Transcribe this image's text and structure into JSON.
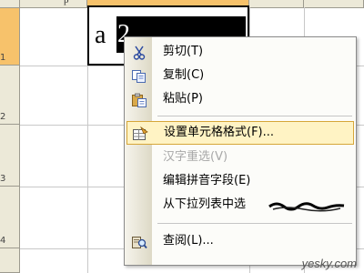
{
  "spreadsheet": {
    "column_header_label": "p",
    "row_labels": [
      "1",
      "2",
      "3",
      "4"
    ],
    "active_cell": {
      "prefix": "a",
      "selected_text": "2"
    }
  },
  "context_menu": {
    "items": [
      {
        "label": "剪切(T)",
        "icon": "scissors-icon",
        "state": "normal"
      },
      {
        "label": "复制(C)",
        "icon": "copy-icon",
        "state": "normal"
      },
      {
        "label": "粘贴(P)",
        "icon": "paste-icon",
        "state": "normal"
      },
      {
        "label": "设置单元格格式(F)...",
        "icon": "format-cells-icon",
        "state": "highlighted"
      },
      {
        "label": "汉字重选(V)",
        "icon": "",
        "state": "disabled"
      },
      {
        "label": "编辑拼音字段(E)",
        "icon": "",
        "state": "normal"
      },
      {
        "label": "从下拉列表中选",
        "icon": "",
        "state": "normal"
      },
      {
        "label": "查阅(L)...",
        "icon": "research-icon",
        "state": "normal"
      }
    ]
  },
  "watermark": "yesky.com",
  "colors": {
    "selected_header": "#f7c26b",
    "menu_highlight": "#fff3c4",
    "menu_highlight_border": "#d6a639"
  }
}
